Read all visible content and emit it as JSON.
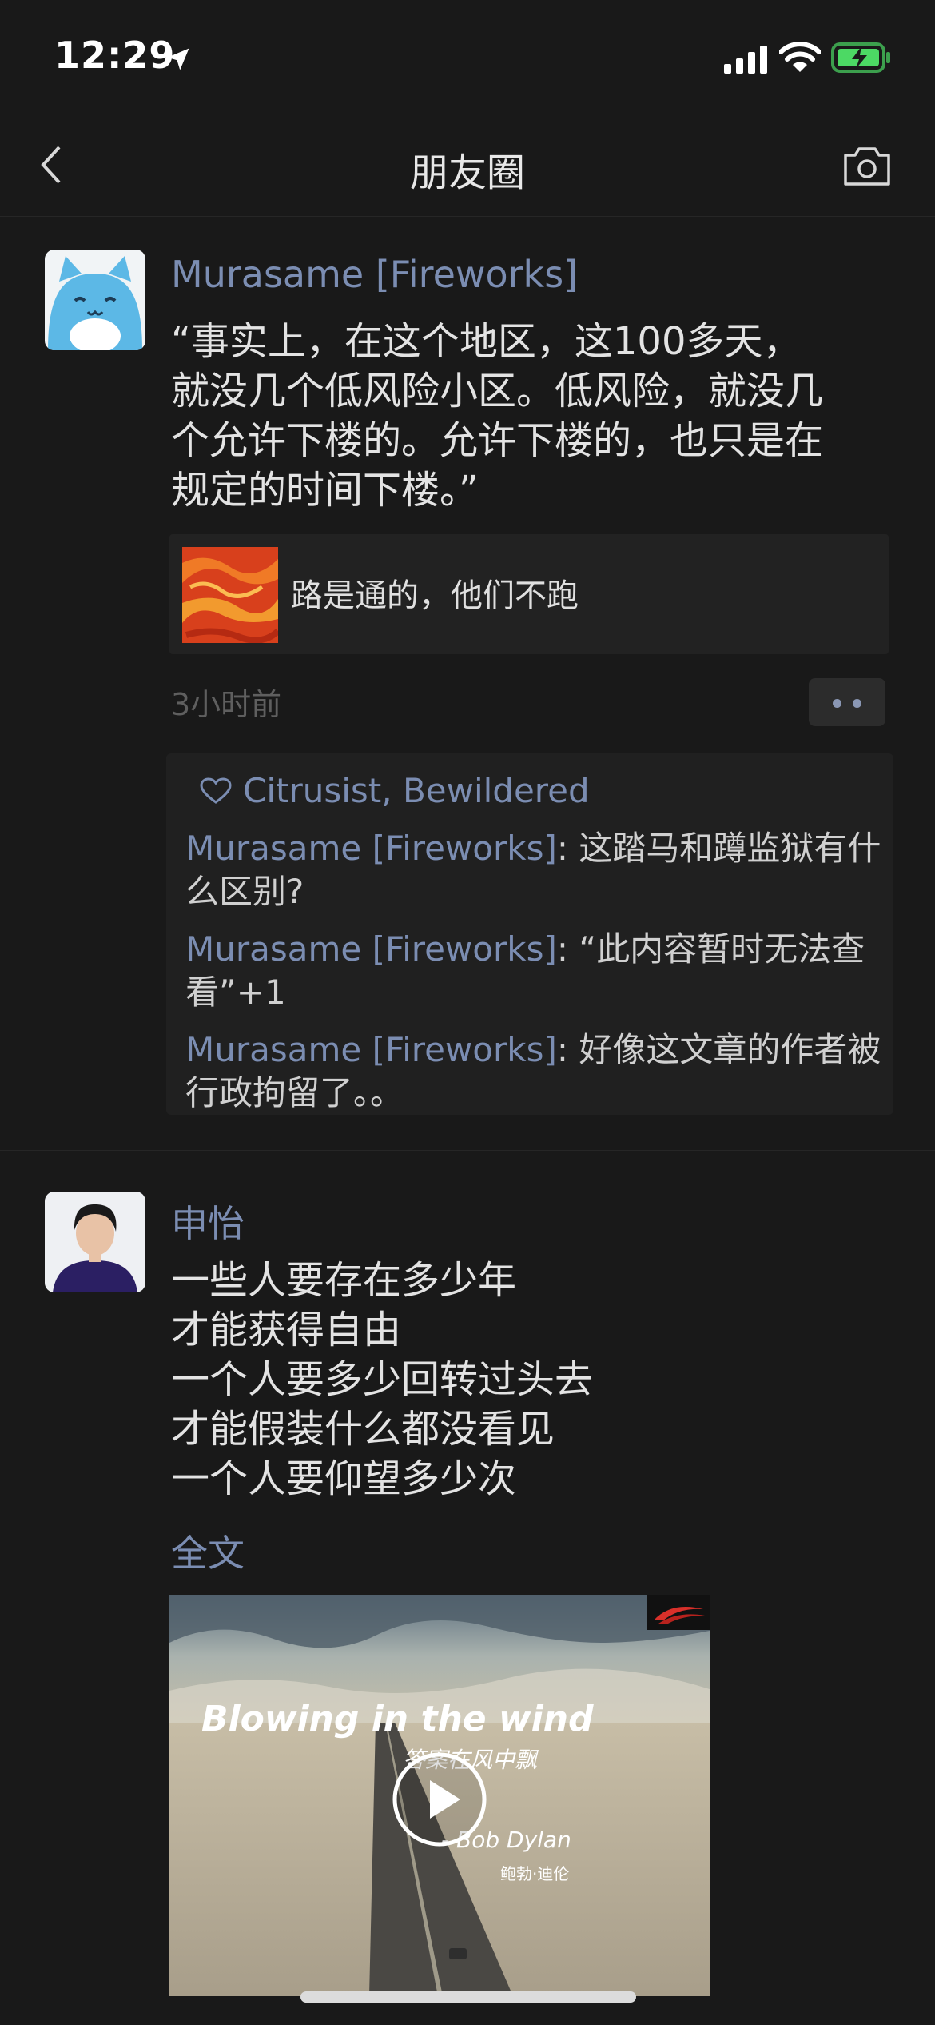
{
  "status_bar": {
    "time": "12:29"
  },
  "nav": {
    "title": "朋友圈"
  },
  "post1": {
    "author": "Murasame [Fireworks]",
    "text": "“事实上，在这个地区，这100多天，\n就没几个低风险小区。低风险，就没几\n个允许下楼的。允许下楼的，也只是在\n规定的时间下楼。”",
    "link_title": "路是通的，他们不跑",
    "time": "3小时前",
    "likes": "Citrusist, Bewildered",
    "comments": [
      {
        "author": "Murasame [Fireworks]",
        "text": ": 这踏马和蹲监狱有什么区别?"
      },
      {
        "author": "Murasame [Fireworks]",
        "text": ": “此内容暂时无法查看”+1"
      },
      {
        "author": "Murasame [Fireworks]",
        "text": ": 好像这文章的作者被行政拘留了。。"
      }
    ]
  },
  "post2": {
    "author": "申怡",
    "text": "一些人要存在多少年\n才能获得自由\n一个人要多少回转过头去\n才能假装什么都没看见\n一个人要仰望多少次",
    "more_label": "全文",
    "video": {
      "title_en": "Blowing in the wind",
      "title_cn": "答案在风中飘",
      "artist_en": "- Bob Dylan",
      "artist_cn": "鲍勃·迪伦"
    }
  },
  "colors": {
    "background": "#191919",
    "name_link": "#7b8db2",
    "text": "#e3e3e3",
    "muted": "#5f5f5f"
  }
}
